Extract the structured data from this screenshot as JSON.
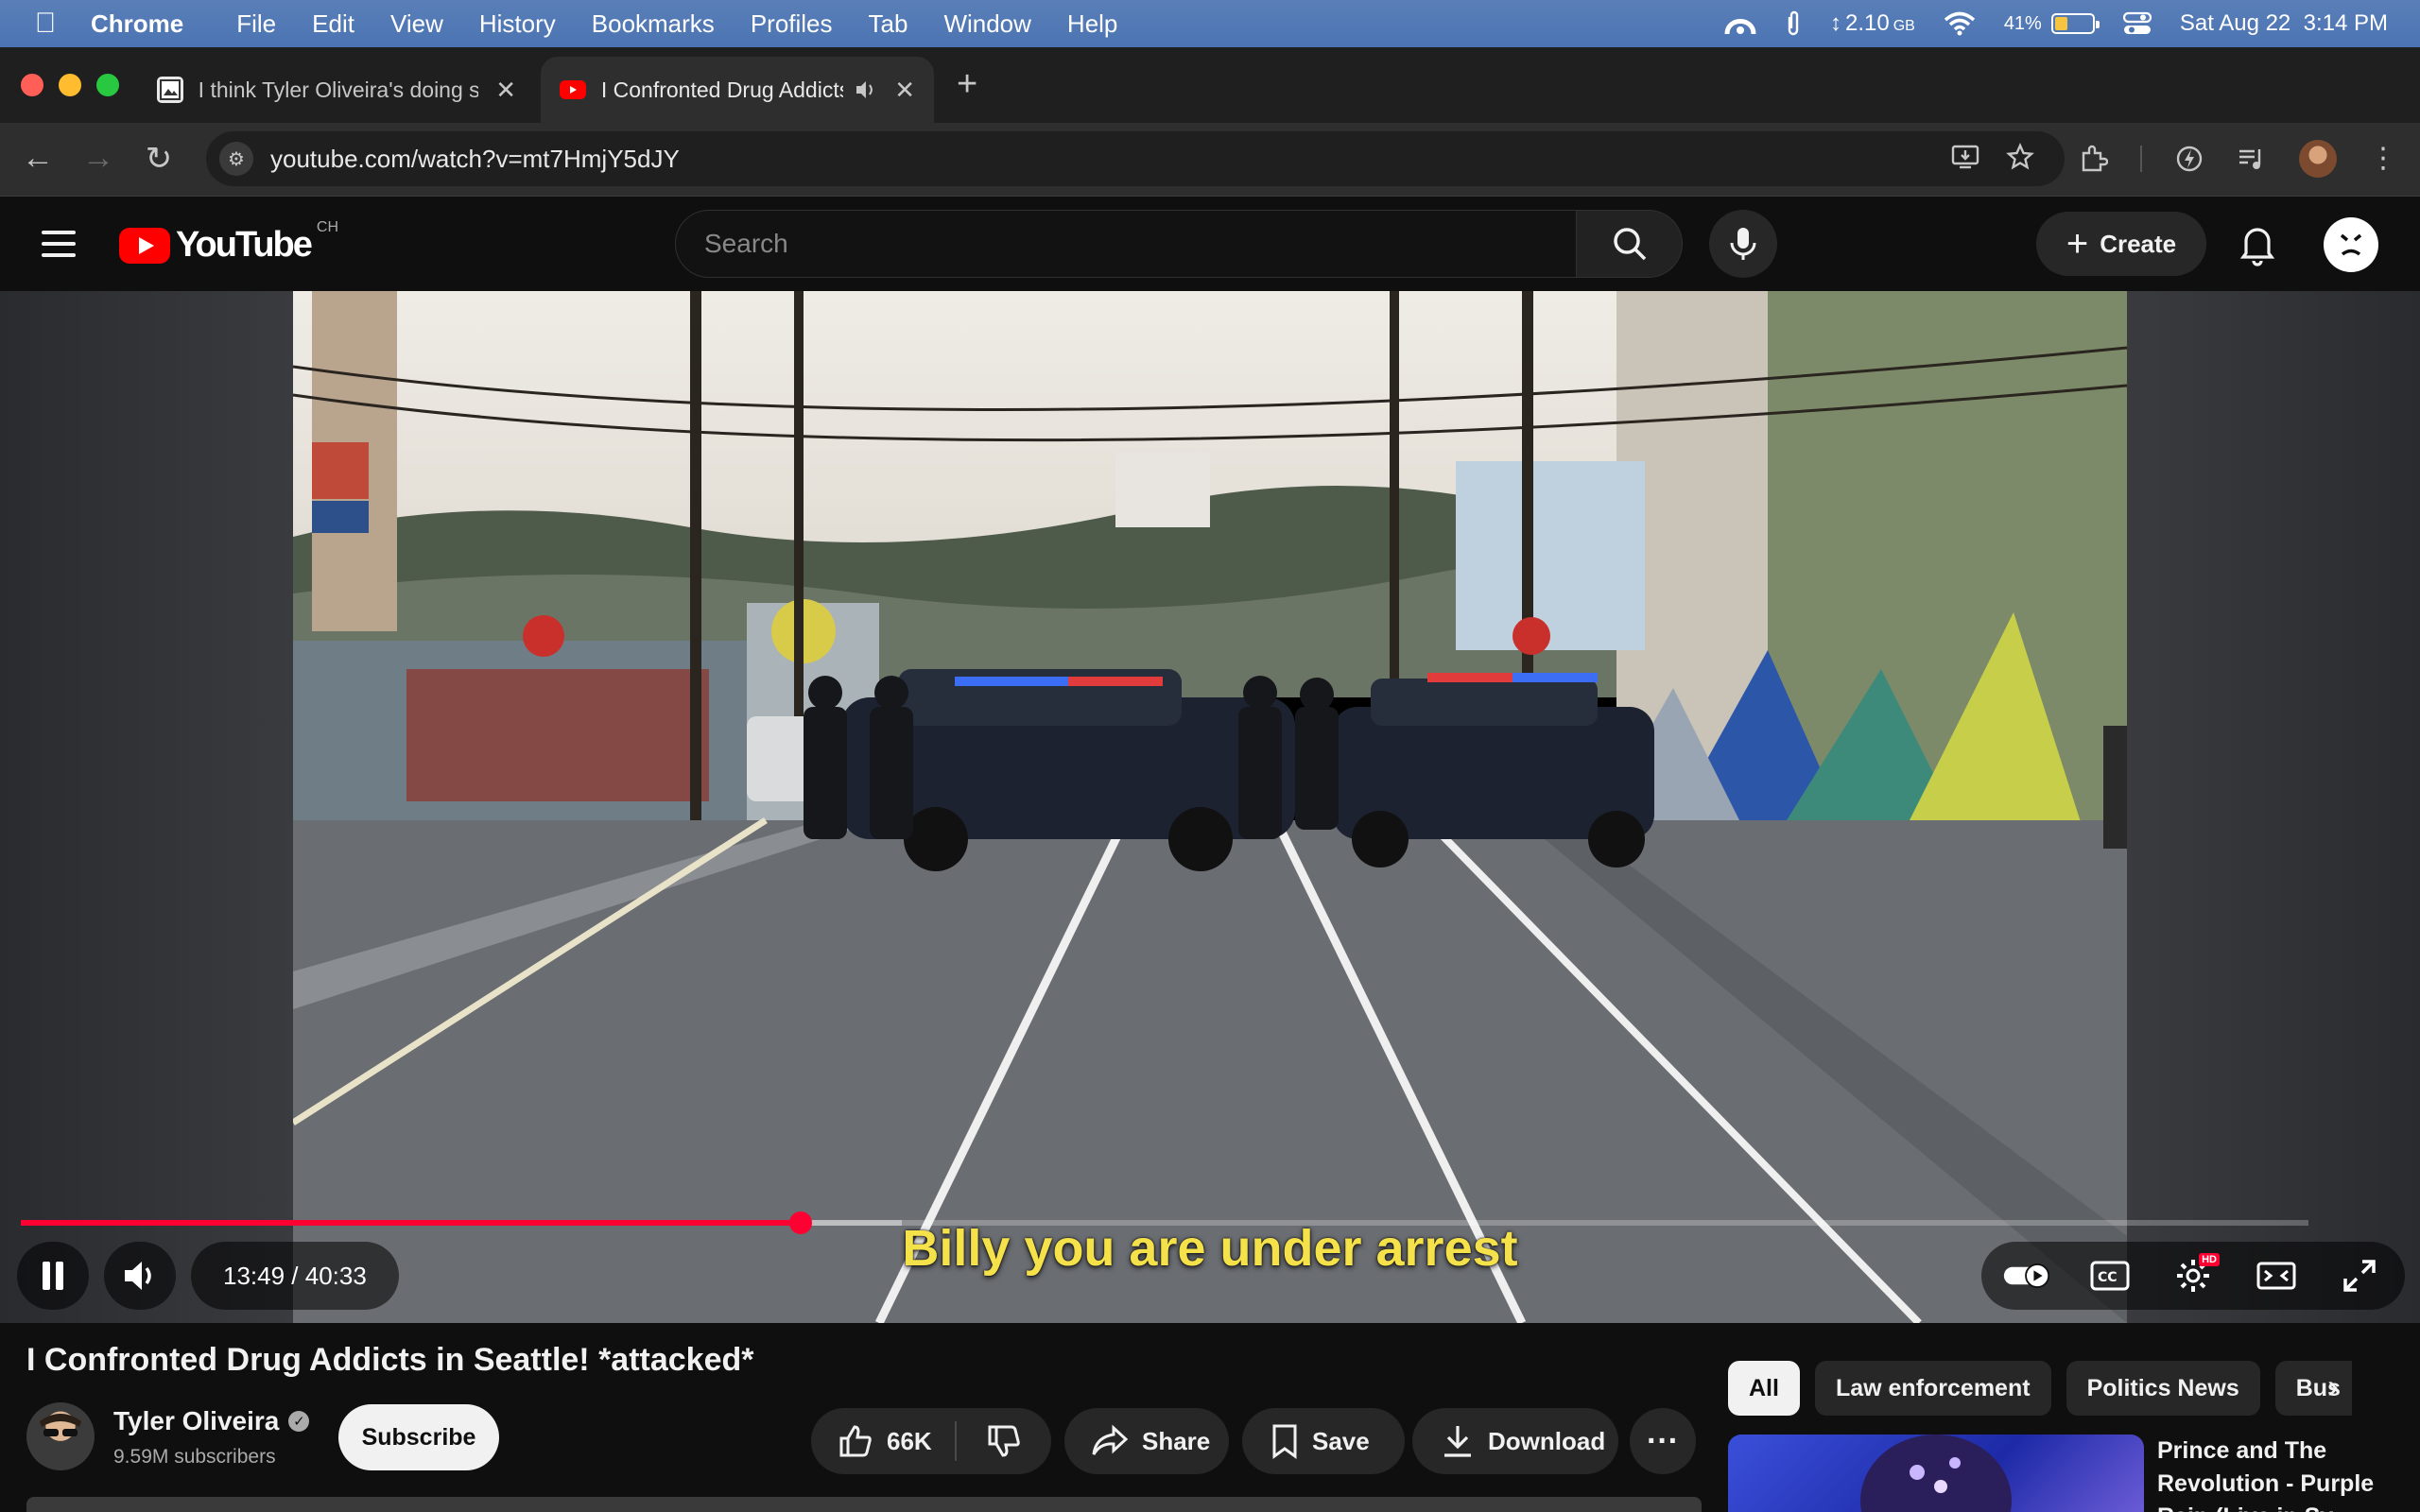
{
  "menubar": {
    "app_name": "Chrome",
    "items": [
      "File",
      "Edit",
      "View",
      "History",
      "Bookmarks",
      "Profiles",
      "Tab",
      "Window",
      "Help"
    ],
    "memory": "2.10",
    "memory_unit": "GB",
    "battery": "41%",
    "battery_level": 0.41,
    "datetime": "Sat Aug 22  3:14 PM"
  },
  "tabs": [
    {
      "title": "I think Tyler Oliveira's doing s",
      "active": false
    },
    {
      "title": "I Confronted Drug Addicts",
      "active": true
    }
  ],
  "toolbar": {
    "url": "youtube.com/watch?v=mt7HmjY5dJY"
  },
  "youtube": {
    "logo_text": "YouTube",
    "country_code": "CH",
    "search_placeholder": "Search",
    "create_label": "Create"
  },
  "player": {
    "subtitle": "Billy you are under arrest",
    "current_time": "13:49",
    "duration": "40:33",
    "time_display": "13:49 / 40:33",
    "progress_fraction": 0.341,
    "buffered_fraction": 0.385,
    "hd_badge": "HD"
  },
  "video": {
    "title": "I Confronted Drug Addicts in Seattle! *attacked*",
    "channel_name": "Tyler Oliveira",
    "subscribers": "9.59M subscribers",
    "subscribe_label": "Subscribe",
    "likes": "66K",
    "share_label": "Share",
    "save_label": "Save",
    "download_label": "Download"
  },
  "chips": [
    "All",
    "Law enforcement",
    "Politics News",
    "Bus"
  ],
  "recommendation": {
    "title": "Prince and The Revolution - Purple Rain (Live in Sy"
  },
  "colors": {
    "accent_red": "#ff0033",
    "subtitle_yellow": "#f5e24a",
    "page_bg": "#0f0f0f"
  }
}
